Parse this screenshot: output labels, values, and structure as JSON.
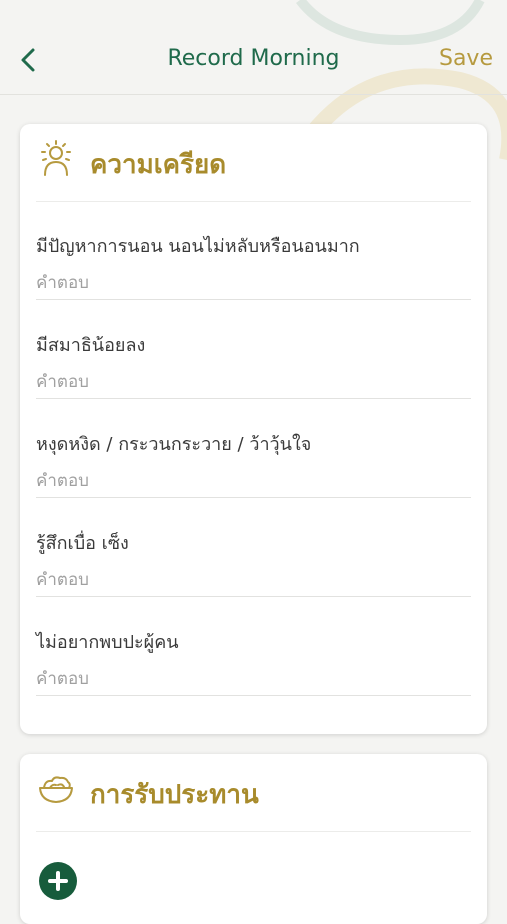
{
  "header": {
    "title": "Record Morning",
    "save_label": "Save"
  },
  "stress_card": {
    "title": "ความเครียด",
    "placeholder": "คำตอบ",
    "questions": [
      {
        "label": "มีปัญหาการนอน นอนไม่หลับหรือนอนมาก",
        "value": ""
      },
      {
        "label": "มีสมาธิน้อยลง",
        "value": ""
      },
      {
        "label": "หงุดหงิด / กระวนกระวาย / ว้าวุ้นใจ",
        "value": ""
      },
      {
        "label": "รู้สึกเบื่อ เซ็ง",
        "value": ""
      },
      {
        "label": "ไม่อยากพบปะผู้คน",
        "value": ""
      }
    ]
  },
  "meal_card": {
    "title": "การรับประทาน"
  },
  "colors": {
    "primary_green": "#1f6a4b",
    "gold": "#b69a3f",
    "card_title_gold": "#a88b2c",
    "add_button": "#175c3c"
  },
  "icons": [
    "chevron-left-icon",
    "stressed-person-icon",
    "food-bowl-icon",
    "plus-icon"
  ]
}
